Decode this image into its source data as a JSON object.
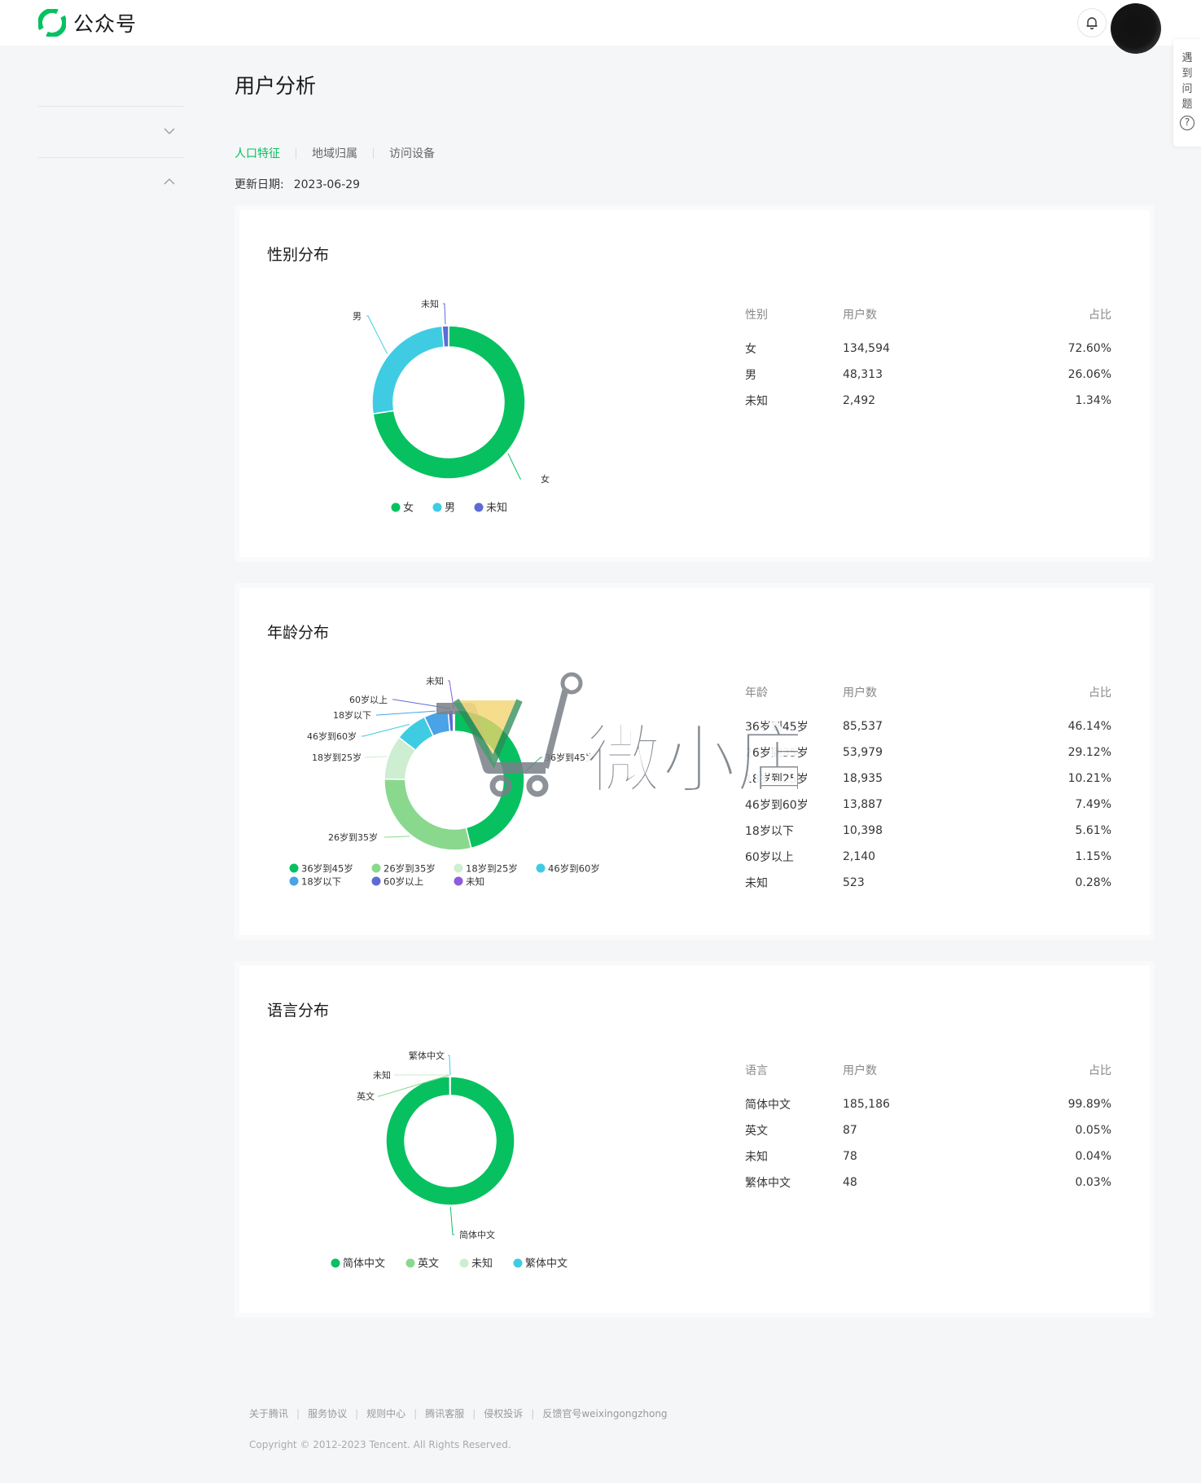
{
  "app": {
    "name": "公众号"
  },
  "help": {
    "label": "遇到问题",
    "icon": "question-icon"
  },
  "page": {
    "title": "用户分析"
  },
  "tabs": [
    {
      "label": "人口特征",
      "active": true
    },
    {
      "label": "地域归属",
      "active": false
    },
    {
      "label": "访问设备",
      "active": false
    }
  ],
  "update": {
    "label": "更新日期:",
    "date": "2023-06-29"
  },
  "gender": {
    "title": "性别分布",
    "headers": [
      "性别",
      "用户数",
      "占比"
    ],
    "rows": [
      {
        "name": "女",
        "count": "134,594",
        "pct": "72.60%"
      },
      {
        "name": "男",
        "count": "48,313",
        "pct": "26.06%"
      },
      {
        "name": "未知",
        "count": "2,492",
        "pct": "1.34%"
      }
    ]
  },
  "age": {
    "title": "年龄分布",
    "headers": [
      "年龄",
      "用户数",
      "占比"
    ],
    "rows": [
      {
        "name": "36岁到45岁",
        "count": "85,537",
        "pct": "46.14%"
      },
      {
        "name": "26岁到35岁",
        "count": "53,979",
        "pct": "29.12%"
      },
      {
        "name": "18岁到25岁",
        "count": "18,935",
        "pct": "10.21%"
      },
      {
        "name": "46岁到60岁",
        "count": "13,887",
        "pct": "7.49%"
      },
      {
        "name": "18岁以下",
        "count": "10,398",
        "pct": "5.61%"
      },
      {
        "name": "60岁以上",
        "count": "2,140",
        "pct": "1.15%"
      },
      {
        "name": "未知",
        "count": "523",
        "pct": "0.28%"
      }
    ]
  },
  "language": {
    "title": "语言分布",
    "headers": [
      "语言",
      "用户数",
      "占比"
    ],
    "rows": [
      {
        "name": "简体中文",
        "count": "185,186",
        "pct": "99.89%"
      },
      {
        "name": "英文",
        "count": "87",
        "pct": "0.05%"
      },
      {
        "name": "未知",
        "count": "78",
        "pct": "0.04%"
      },
      {
        "name": "繁体中文",
        "count": "48",
        "pct": "0.03%"
      }
    ]
  },
  "chart_data": [
    {
      "type": "pie",
      "title": "性别分布",
      "categories": [
        "女",
        "男",
        "未知"
      ],
      "values": [
        134594,
        48313,
        2492
      ],
      "colors": [
        "#07c160",
        "#3fcce3",
        "#5c6bd6"
      ],
      "legend": "bottom"
    },
    {
      "type": "pie",
      "title": "年龄分布",
      "categories": [
        "36岁到45岁",
        "26岁到35岁",
        "18岁到25岁",
        "46岁到60岁",
        "18岁以下",
        "60岁以上",
        "未知"
      ],
      "values": [
        85537,
        53979,
        18935,
        13887,
        10398,
        2140,
        523
      ],
      "colors": [
        "#07c160",
        "#8ad88e",
        "#cdeed0",
        "#3fcce3",
        "#4aa3e6",
        "#5c6bd6",
        "#8e5cd9"
      ],
      "legend": "bottom"
    },
    {
      "type": "pie",
      "title": "语言分布",
      "categories": [
        "简体中文",
        "英文",
        "未知",
        "繁体中文"
      ],
      "values": [
        185186,
        87,
        78,
        48
      ],
      "colors": [
        "#07c160",
        "#8ad88e",
        "#cdeed0",
        "#3fcce3"
      ],
      "legend": "bottom"
    }
  ],
  "footer": {
    "links": [
      "关于腾讯",
      "服务协议",
      "规则中心",
      "腾讯客服",
      "侵权投诉",
      "反馈官号weixingongzhong"
    ],
    "copyright": "Copyright © 2012-2023 Tencent. All Rights Reserved."
  },
  "watermark": {
    "text": "微小店"
  }
}
